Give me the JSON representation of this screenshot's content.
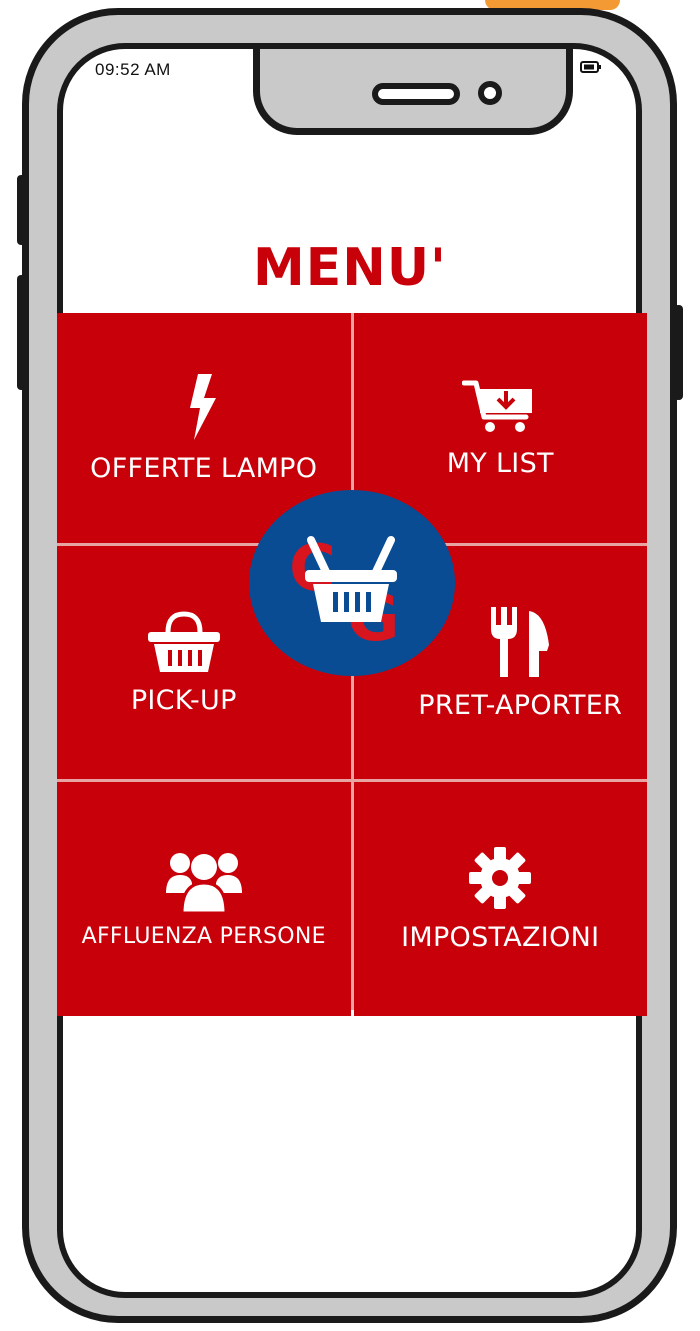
{
  "status_bar": {
    "time": "09:52 AM"
  },
  "header": {
    "title": "MENU'"
  },
  "menu": {
    "items": [
      {
        "label": "OFFERTE LAMPO",
        "icon": "lightning-icon"
      },
      {
        "label": "MY LIST",
        "icon": "cart-download-icon"
      },
      {
        "label": "PICK-UP",
        "icon": "basket-icon"
      },
      {
        "label": "PRET-APORTER",
        "icon": "fork-knife-icon"
      },
      {
        "label": "AFFLUENZA PERSONE",
        "icon": "people-icon"
      },
      {
        "label": "IMPOSTAZIONI",
        "icon": "gear-icon"
      }
    ]
  },
  "logo": {
    "letters": [
      "C",
      "G"
    ],
    "icon": "basket-icon"
  },
  "colors": {
    "brand_red": "#c8000a",
    "logo_blue": "#0a4c93",
    "frame_gray": "#c9c9c9",
    "accent_orange": "#f39a34"
  }
}
